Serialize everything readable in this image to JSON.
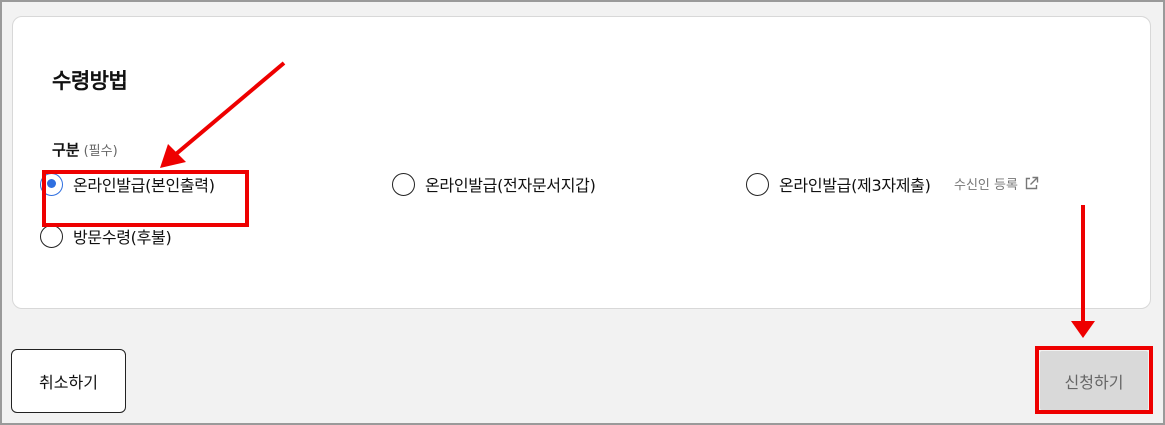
{
  "section": {
    "title": "수령방법",
    "field_label": "구분",
    "required_label": "(필수)"
  },
  "options": [
    {
      "label": "온라인발급(본인출력)",
      "checked": true
    },
    {
      "label": "온라인발급(전자문서지갑)",
      "checked": false
    },
    {
      "label": "온라인발급(제3자제출)",
      "checked": false
    },
    {
      "label": "방문수령(후불)",
      "checked": false
    }
  ],
  "recipient_link": {
    "label": "수신인 등록",
    "icon": "external-link-icon"
  },
  "buttons": {
    "cancel": "취소하기",
    "apply": "신청하기"
  },
  "colors": {
    "accent": "#2f6fe0",
    "annotation": "#ee0000",
    "disabled_button": "#d9d9d9"
  }
}
